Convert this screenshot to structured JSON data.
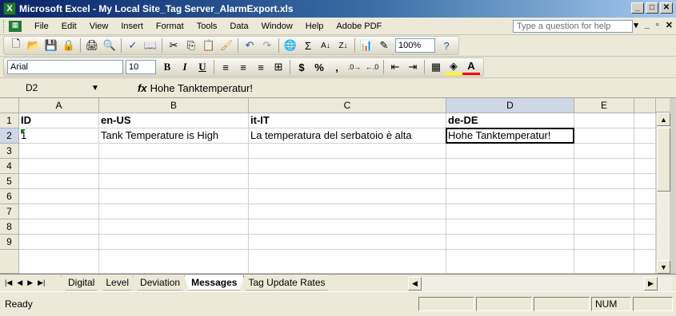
{
  "window": {
    "title": "Microsoft Excel - My Local Site_Tag Server_AlarmExport.xls",
    "app_icon": "X",
    "controls": [
      "_",
      "□",
      "✕"
    ]
  },
  "menubar": {
    "items": [
      "File",
      "Edit",
      "View",
      "Insert",
      "Format",
      "Tools",
      "Data",
      "Window",
      "Help",
      "Adobe PDF"
    ],
    "help_placeholder": "Type a question for help",
    "right_controls": [
      "▾",
      "_",
      "▫",
      "✕"
    ]
  },
  "standard_toolbar": {
    "zoom": "100%"
  },
  "format_toolbar": {
    "font": "Arial",
    "size": "10",
    "bold": "B",
    "italic": "I",
    "underline": "U",
    "currency": "$",
    "percent": "%",
    "comma": ","
  },
  "formula_bar": {
    "name_box": "D2",
    "fx": "fx",
    "value": "Hohe Tanktemperatur!"
  },
  "sheet": {
    "columns": [
      "A",
      "B",
      "C",
      "D",
      "E"
    ],
    "rows": [
      "1",
      "2",
      "3",
      "4",
      "5",
      "6",
      "7",
      "8",
      "9"
    ],
    "header_row": [
      "ID",
      "en-US",
      "it-IT",
      "de-DE"
    ],
    "data_row": [
      "1",
      "Tank Temperature is High",
      "La temperatura del serbatoio è alta",
      "Hohe Tanktemperatur!"
    ],
    "active_cell": "D2"
  },
  "sheet_tabs": {
    "tabs": [
      "Digital",
      "Level",
      "Deviation",
      "Messages",
      "Tag Update Rates"
    ],
    "active": "Messages"
  },
  "statusbar": {
    "status": "Ready",
    "num": "NUM"
  }
}
